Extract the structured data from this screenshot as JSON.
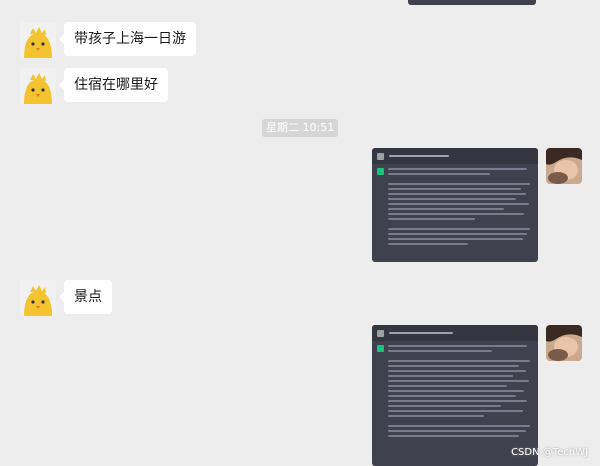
{
  "messages": {
    "m1": "带孩子上海一日游",
    "m2": "住宿在哪里好",
    "m3": "景点"
  },
  "timestamp": "星期二 10:51",
  "watermark": "CSDN @TechWJ",
  "icons": {
    "contact_avatar": "chick-avatar-icon",
    "self_avatar": "user-photo-avatar-icon"
  },
  "colors": {
    "background": "#ededed",
    "bubble": "#ffffff",
    "screenshot_bg": "#40414f",
    "assistant_logo": "#19c37d"
  }
}
